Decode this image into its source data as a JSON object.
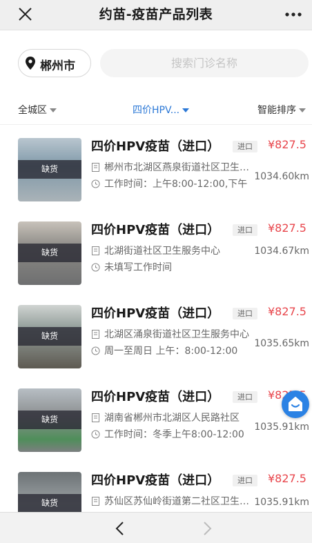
{
  "header": {
    "title": "约苗-疫苗产品列表"
  },
  "search": {
    "city": "郴州市",
    "placeholder": "搜索门诊名称"
  },
  "filters": {
    "area": "全城区",
    "vaccine": "四价HPV...",
    "sort": "智能排序"
  },
  "accent_color": "#2b78d6",
  "price_color": "#e8454b",
  "clinics": [
    {
      "name": "四价HPV疫苗（进口）",
      "tag": "进口",
      "price": "¥827.5",
      "status": "缺货",
      "address": "郴州市北湖区燕泉街道社区卫生服务中心",
      "hours": "工作时间：上午8:00-12:00,下午",
      "distance": "1034.60km"
    },
    {
      "name": "四价HPV疫苗（进口）",
      "tag": "进口",
      "price": "¥827.5",
      "status": "缺货",
      "address": "北湖街道社区卫生服务中心",
      "hours": "未填写工作时间",
      "distance": "1034.67km"
    },
    {
      "name": "四价HPV疫苗（进口）",
      "tag": "进口",
      "price": "¥827.5",
      "status": "缺货",
      "address": "北湖区涌泉街道社区卫生服务中心",
      "hours": "周一至周日 上午：8:00-12:00",
      "distance": "1035.65km"
    },
    {
      "name": "四价HPV疫苗（进口）",
      "tag": "进口",
      "price": "¥827.5",
      "status": "缺货",
      "address": "湖南省郴州市北湖区人民路社区",
      "hours": "工作时间：冬季上午8:00-12:00",
      "distance": "1035.91km"
    },
    {
      "name": "四价HPV疫苗（进口）",
      "tag": "进口",
      "price": "¥827.5",
      "status": "缺货",
      "address": "苏仙区苏仙岭街道第二社区卫生服务站",
      "hours": "",
      "distance": "1035.91km"
    }
  ],
  "icons": {
    "close": "close-icon",
    "more": "more-icon",
    "location": "location-pin-icon",
    "address": "building-icon",
    "clock": "clock-icon",
    "service": "customer-service-icon",
    "back": "chevron-left-icon",
    "forward": "chevron-right-icon"
  }
}
